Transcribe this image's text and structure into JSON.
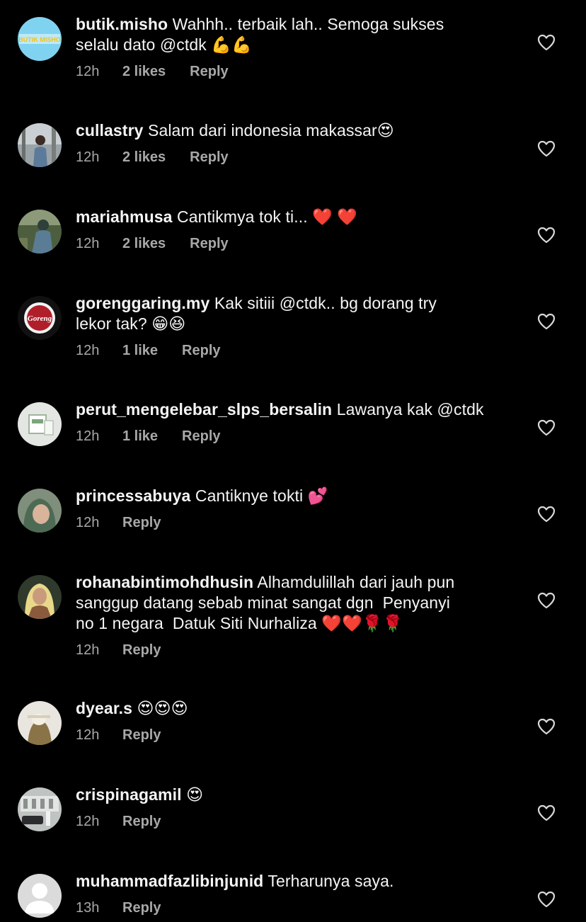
{
  "colors": {
    "background": "#000000",
    "text": "#f5f5f5",
    "meta": "#a8a8a8",
    "heart_outline": "#d9d9d9"
  },
  "comments": [
    {
      "username": "butik.misho",
      "text": "Wahhh.. terbaik lah.. Semoga sukses\nselalu dato @ctdk 💪💪",
      "time": "12h",
      "likes": "2 likes",
      "reply": "Reply",
      "avatar_label": "BUTIK MISHO",
      "avatar_icon": "butik-misho-logo"
    },
    {
      "username": "cullastry",
      "text": "Salam dari indonesia makassar😍",
      "time": "12h",
      "likes": "2 likes",
      "reply": "Reply",
      "avatar_icon": "profile-photo"
    },
    {
      "username": "mariahmusa",
      "text": "Cantikmya tok ti... ❤️ ❤️",
      "time": "12h",
      "likes": "2 likes",
      "reply": "Reply",
      "avatar_icon": "profile-photo"
    },
    {
      "username": "gorenggaring.my",
      "text": "Kak sitiii @ctdk.. bg dorang try\nlekor tak? 😁😆",
      "time": "12h",
      "likes": "1 like",
      "reply": "Reply",
      "avatar_label": "Goreng",
      "avatar_icon": "goreng-logo"
    },
    {
      "username": "perut_mengelebar_slps_bersalin",
      "text": "Lawanya kak @ctdk",
      "time": "12h",
      "likes": "1 like",
      "reply": "Reply",
      "avatar_icon": "product-photo"
    },
    {
      "username": "princessabuya",
      "text": "Cantiknye tokti 💕",
      "time": "12h",
      "likes": "",
      "reply": "Reply",
      "avatar_icon": "profile-photo"
    },
    {
      "username": "rohanabintimohdhusin",
      "text": "Alhamdulillah dari jauh pun\nsanggup datang sebab minat sangat dgn  Penyanyi\nno 1 negara  Datuk Siti Nurhaliza ❤️❤️🌹🌹",
      "time": "12h",
      "likes": "",
      "reply": "Reply",
      "avatar_icon": "profile-photo"
    },
    {
      "username": "dyear.s",
      "text": "😍😍😍",
      "time": "12h",
      "likes": "",
      "reply": "Reply",
      "avatar_icon": "profile-photo"
    },
    {
      "username": "crispinagamil",
      "text": "😍",
      "time": "12h",
      "likes": "",
      "reply": "Reply",
      "avatar_icon": "profile-photo"
    },
    {
      "username": "muhammadfazlibinjunid",
      "text": "Terharunya saya.",
      "time": "13h",
      "likes": "",
      "reply": "Reply",
      "avatar_icon": "default-avatar-icon"
    }
  ]
}
